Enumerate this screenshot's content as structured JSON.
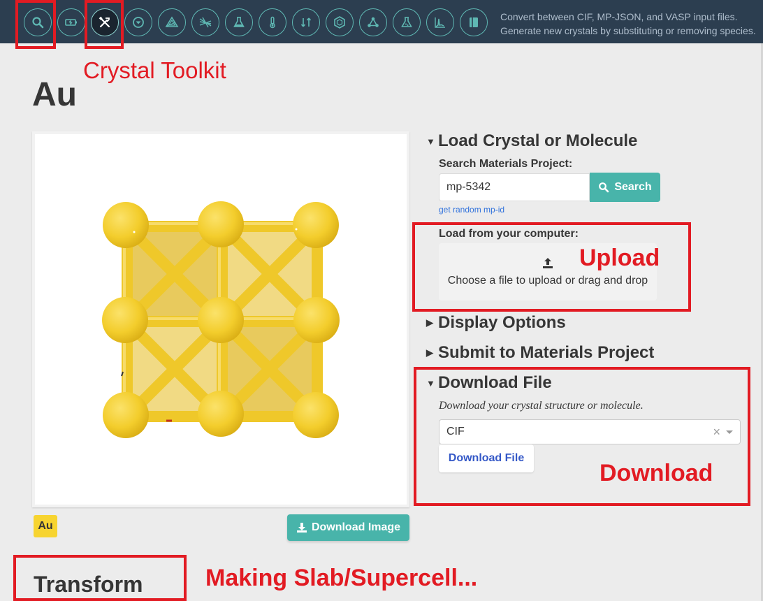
{
  "toolbar": {
    "buttons": [
      {
        "name": "search-icon",
        "active": false
      },
      {
        "name": "battery-icon",
        "active": false
      },
      {
        "name": "tools-icon",
        "active": true
      },
      {
        "name": "chevron-circle-down-icon",
        "active": false
      },
      {
        "name": "triangle-layers-icon",
        "active": false
      },
      {
        "name": "diffraction-lines-icon",
        "active": false
      },
      {
        "name": "flask-icon",
        "active": false
      },
      {
        "name": "thermometer-icon",
        "active": false
      },
      {
        "name": "swap-arrows-icon",
        "active": false
      },
      {
        "name": "polyhedron-icon",
        "active": false
      },
      {
        "name": "molecule-icon",
        "active": false
      },
      {
        "name": "flask-alt-icon",
        "active": false
      },
      {
        "name": "spectrum-icon",
        "active": false
      },
      {
        "name": "book-icon",
        "active": false
      }
    ],
    "description_line1": "Convert between CIF, MP-JSON, and VASP input files.",
    "description_line2": "Generate new crystals by substituting or removing species."
  },
  "annotations": {
    "crystal_toolkit": "Crystal Toolkit",
    "upload": "Upload",
    "download": "Download",
    "making_slab": "Making Slab/Supercell..."
  },
  "page": {
    "title": "Au",
    "element_tag": "Au",
    "download_image_label": "Download Image",
    "transform_title": "Transform"
  },
  "load_section": {
    "title": "Load Crystal or Molecule",
    "search_label": "Search Materials Project:",
    "search_value": "mp-5342",
    "search_button": "Search",
    "random_link": "get random mp-id",
    "upload_label": "Load from your computer:",
    "upload_text": "Choose a file to upload or drag and drop"
  },
  "display_options": {
    "title": "Display Options"
  },
  "submit_section": {
    "title": "Submit to Materials Project"
  },
  "download_section": {
    "title": "Download File",
    "description": "Download your crystal structure or molecule.",
    "format_value": "CIF",
    "clear_symbol": "×",
    "download_button": "Download File"
  },
  "colors": {
    "toolbar_bg": "#2c3e50",
    "accent": "#48b4aa",
    "annotation_red": "#e21b23",
    "atom_gold": "#f5cf2e"
  }
}
